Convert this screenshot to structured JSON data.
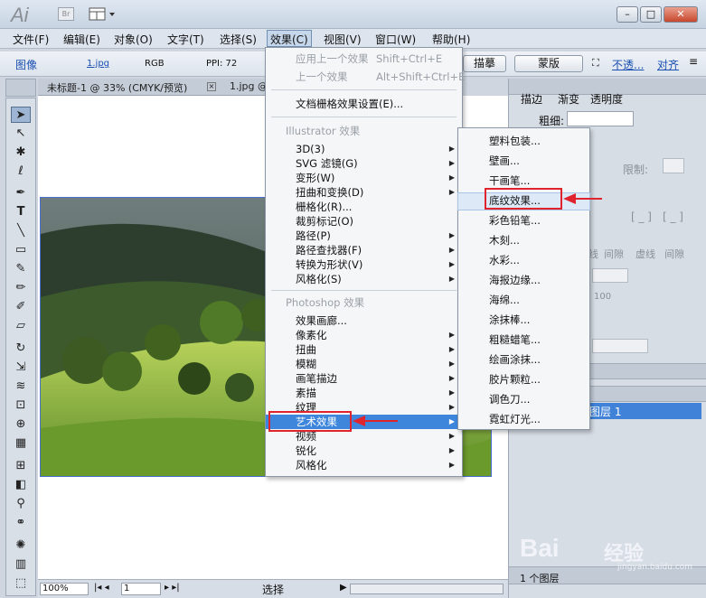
{
  "title_bar": {
    "logo": "Ai",
    "br_label": "Br"
  },
  "menubar": {
    "items": [
      "文件(F)",
      "编辑(E)",
      "对象(O)",
      "文字(T)",
      "选择(S)",
      "效果(C)",
      "视图(V)",
      "窗口(W)",
      "帮助(H)"
    ]
  },
  "control_bar": {
    "image_label": "图像",
    "file": "1.jpg",
    "mode": "RGB",
    "ppi": "PPI: 72",
    "btn_trace": "描摹",
    "btn_mask": "蒙版",
    "opacity_link": "不透...",
    "align_link": "对齐"
  },
  "document": {
    "tabs": [
      "未标题-1 @ 33% (CMYK/预览)",
      "1.jpg @"
    ],
    "zoom": "100%",
    "page": "1",
    "status": "选择"
  },
  "panels": {
    "tabs": [
      "描边",
      "渐变",
      "透明度"
    ],
    "weight_label": "粗细:",
    "limit_label": "限制:",
    "dash_labels": [
      "线",
      "间隙",
      "虚线",
      "间隙"
    ],
    "percent": "100",
    "layer_name": "图层 1",
    "layer_count": "1 个图层"
  },
  "effects_menu": {
    "items": [
      {
        "label": "应用上一个效果",
        "shortcut": "Shift+Ctrl+E",
        "disabled": true
      },
      {
        "label": "上一个效果",
        "shortcut": "Alt+Shift+Ctrl+E",
        "disabled": true
      },
      {
        "label": "文档栅格效果设置(E)..."
      },
      {
        "label": "Illustrator 效果",
        "disabled": true
      },
      {
        "label": "3D(3)",
        "submenu": true
      },
      {
        "label": "SVG 滤镜(G)",
        "submenu": true
      },
      {
        "label": "变形(W)",
        "submenu": true
      },
      {
        "label": "扭曲和变换(D)",
        "submenu": true
      },
      {
        "label": "栅格化(R)..."
      },
      {
        "label": "裁剪标记(O)"
      },
      {
        "label": "路径(P)",
        "submenu": true
      },
      {
        "label": "路径查找器(F)",
        "submenu": true
      },
      {
        "label": "转换为形状(V)",
        "submenu": true
      },
      {
        "label": "风格化(S)",
        "submenu": true
      },
      {
        "label": "Photoshop 效果",
        "disabled": true
      },
      {
        "label": "效果画廊..."
      },
      {
        "label": "像素化",
        "submenu": true
      },
      {
        "label": "扭曲",
        "submenu": true
      },
      {
        "label": "模糊",
        "submenu": true
      },
      {
        "label": "画笔描边",
        "submenu": true
      },
      {
        "label": "素描",
        "submenu": true
      },
      {
        "label": "纹理",
        "submenu": true
      },
      {
        "label": "艺术效果",
        "submenu": true,
        "highlighted": true
      },
      {
        "label": "视频",
        "submenu": true
      },
      {
        "label": "锐化",
        "submenu": true
      },
      {
        "label": "风格化",
        "submenu": true
      }
    ]
  },
  "art_submenu": {
    "items": [
      "塑料包装...",
      "壁画...",
      "干画笔...",
      "底纹效果...",
      "彩色铅笔...",
      "木刻...",
      "水彩...",
      "海报边缘...",
      "海绵...",
      "涂抹棒...",
      "粗糙蜡笔...",
      "绘画涂抹...",
      "胶片颗粒...",
      "调色刀...",
      "霓虹灯光..."
    ],
    "highlighted_index": 3
  },
  "watermark": {
    "brand": "Bai",
    "brand2": "经验",
    "site": "jingyan.baidu.com"
  },
  "colors": {
    "highlight": "#3d86dc",
    "annotation": "#e0242e",
    "panel": "#d7dde5"
  }
}
